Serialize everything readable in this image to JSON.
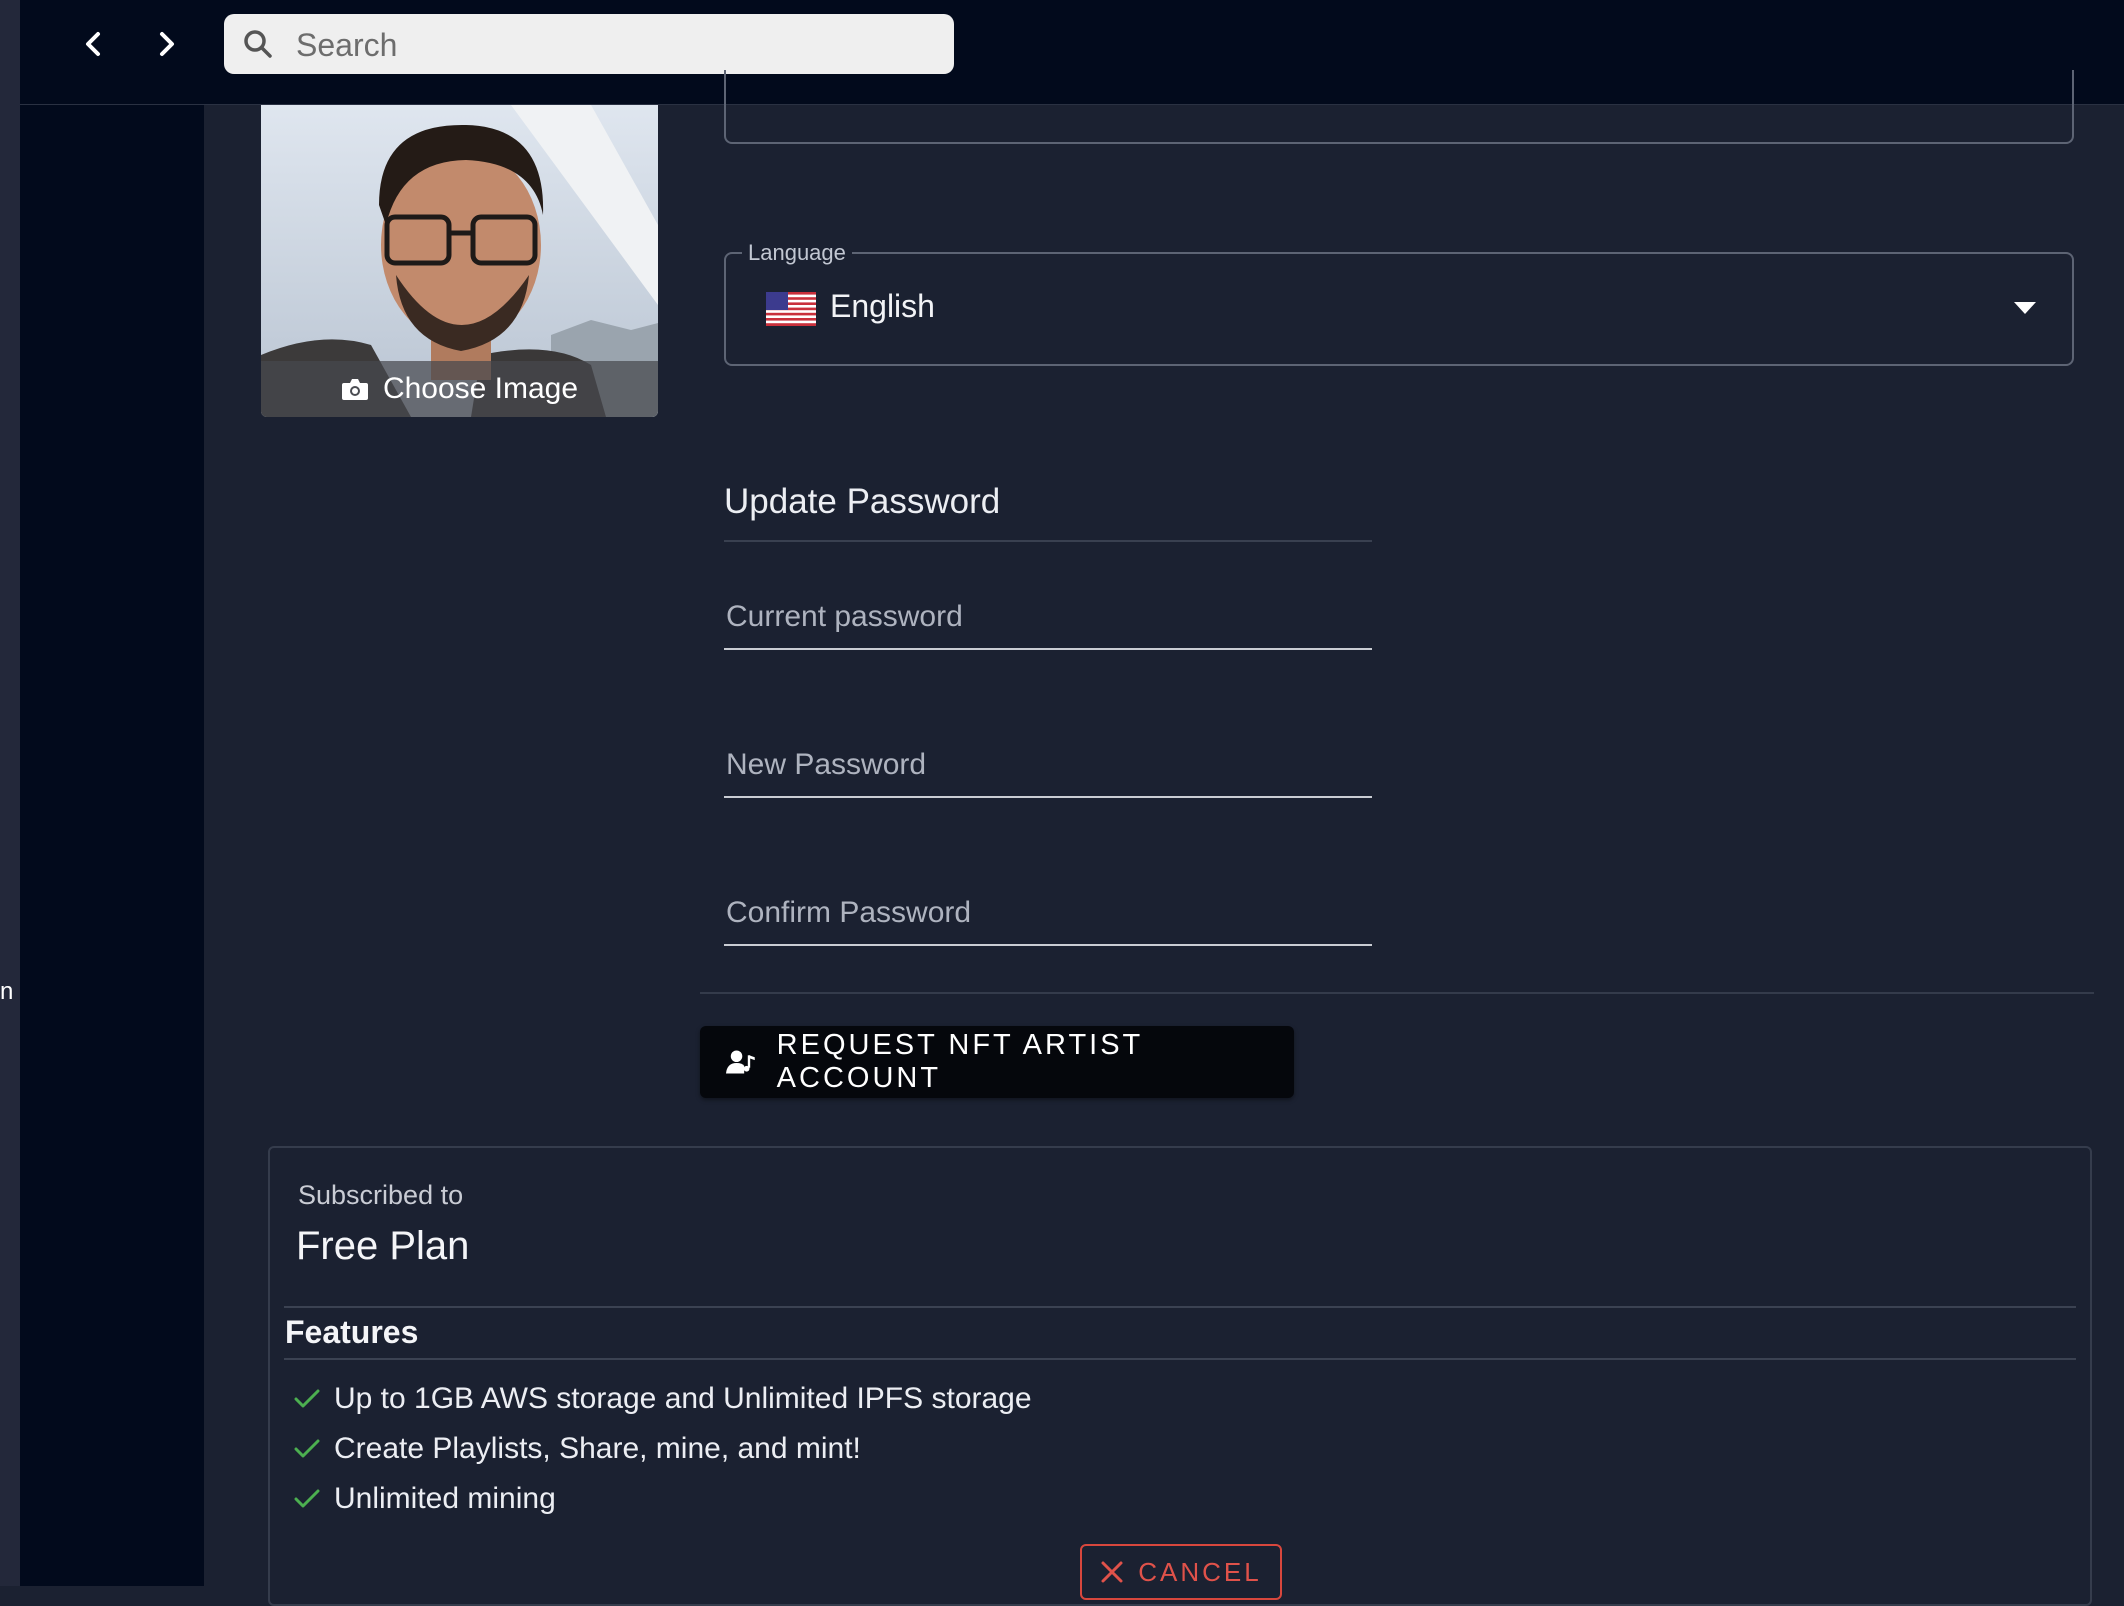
{
  "topbar": {
    "search_placeholder": "Search",
    "icons": {
      "back": "chevron-left-icon",
      "forward": "chevron-right-icon",
      "search": "search-icon"
    }
  },
  "profile": {
    "choose_image_label": "Choose Image"
  },
  "language": {
    "legend": "Language",
    "value": "English",
    "flag": "us-flag-icon"
  },
  "password": {
    "heading": "Update Password",
    "current_placeholder": "Current password",
    "new_placeholder": "New Password",
    "confirm_placeholder": "Confirm Password"
  },
  "nft_button": {
    "label": "REQUEST NFT ARTIST ACCOUNT"
  },
  "subscription": {
    "subscribed_label": "Subscribed to",
    "plan_name": "Free Plan",
    "features_heading": "Features",
    "features": [
      "Up to 1GB AWS storage and Unlimited IPFS storage",
      "Create Playlists, Share, mine, and mint!",
      "Unlimited mining"
    ],
    "cancel_label": "CANCEL"
  },
  "colors": {
    "page_bg": "#1b2131",
    "topbar_bg": "#020a1c",
    "check": "#4caf50",
    "cancel": "#e0524a"
  }
}
